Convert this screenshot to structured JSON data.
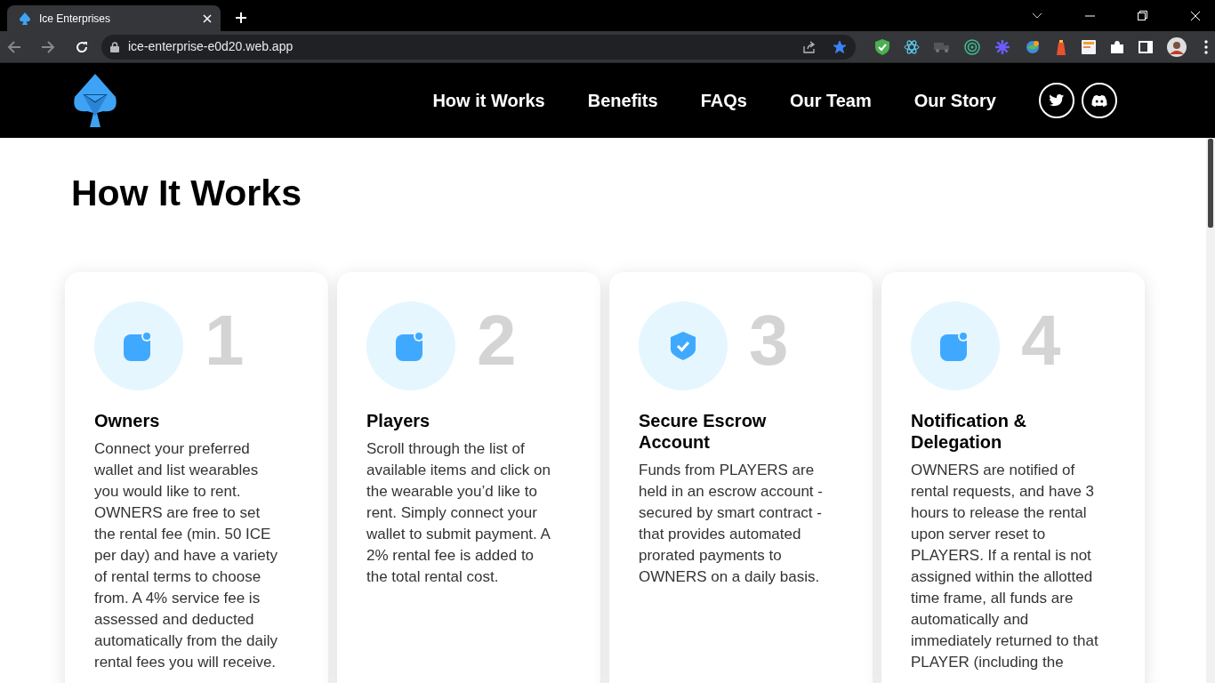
{
  "browser": {
    "tab_title": "Ice Enterprises",
    "address": "ice-enterprise-e0d20.web.app",
    "bookmarked": true
  },
  "nav": {
    "links": [
      "How it Works",
      "Benefits",
      "FAQs",
      "Our Team",
      "Our Story"
    ]
  },
  "heading": "How It Works",
  "steps": [
    {
      "number": "1",
      "kind": "app",
      "title": "Owners",
      "text": "Connect your preferred wallet and list wearables you would like to rent. OWNERS are free to set the rental fee (min. 50 ICE per day) and have a variety of rental terms to choose from. A 4% service fee is assessed and deducted automatically from the daily rental fees you will receive."
    },
    {
      "number": "2",
      "kind": "app",
      "title": "Players",
      "text": "Scroll through the list of available items and click on the wearable you’d like to rent. Simply connect your wallet to submit payment. A 2% rental fee is added to the total rental cost."
    },
    {
      "number": "3",
      "kind": "shield",
      "title": "Secure Escrow Account",
      "text": "Funds from PLAYERS are held in an escrow account - secured by smart contract - that provides automated prorated payments to OWNERS on a daily basis."
    },
    {
      "number": "4",
      "kind": "app",
      "title": "Notification & Delegation",
      "text": "OWNERS are notified of rental requests, and have 3 hours to release the rental upon server reset to PLAYERS. If a rental is not assigned within the allotted time frame, all funds are automatically and immediately returned to that PLAYER (including the"
    }
  ]
}
